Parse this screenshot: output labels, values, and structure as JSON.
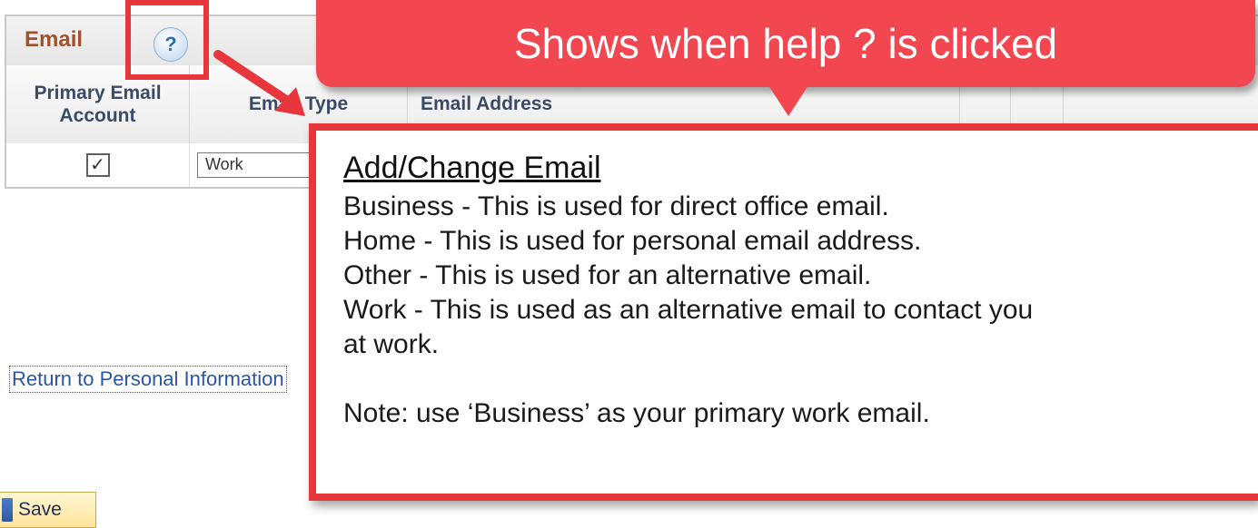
{
  "email_grid": {
    "title": "Email",
    "help_icon_glyph": "?",
    "columns": {
      "primary": "Primary Email Account",
      "type": "Email Type",
      "address": "Email Address"
    },
    "row": {
      "primary_checked_glyph": "✓",
      "email_type": "Work"
    }
  },
  "return_link": "Return to Personal Information",
  "save_button": {
    "label": "Save",
    "icon": "save-icon"
  },
  "annotation": {
    "banner_text": "Shows when help ? is clicked",
    "accent_color": "#f24750"
  },
  "help_popup": {
    "title": "Add/Change Email",
    "lines": [
      "Business - This is used for direct office email.",
      "Home - This is used for personal email address.",
      "Other - This is used for an alternative email.",
      "Work - This is used as an alternative email to contact you",
      "at work."
    ],
    "note": "Note: use ‘Business’ as your primary work email."
  }
}
